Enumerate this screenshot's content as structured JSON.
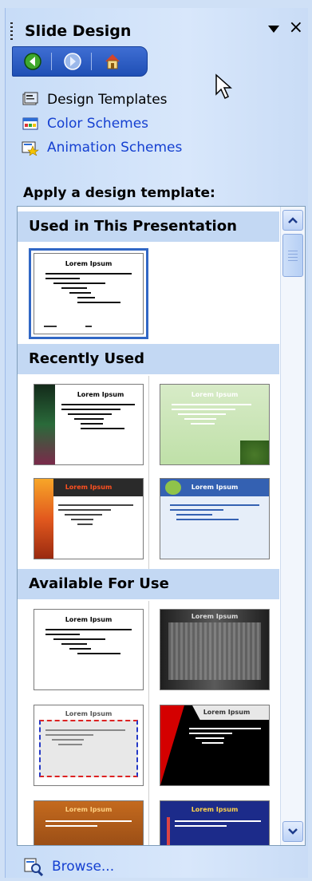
{
  "pane": {
    "title": "Slide Design",
    "close_glyph": "×",
    "menu_icon": "dropdown-arrow-icon",
    "nav": {
      "back_icon": "back-arrow-icon",
      "forward_icon": "forward-arrow-icon",
      "home_icon": "home-icon"
    }
  },
  "links": [
    {
      "label": "Design Templates",
      "icon": "design-templates-icon",
      "active": true
    },
    {
      "label": "Color Schemes",
      "icon": "color-schemes-icon",
      "active": false
    },
    {
      "label": "Animation Schemes",
      "icon": "animation-schemes-icon",
      "active": false
    }
  ],
  "apply_label": "Apply a design template:",
  "gallery": {
    "sections": [
      {
        "title": "Used in This Presentation"
      },
      {
        "title": "Recently Used"
      },
      {
        "title": "Available For Use"
      }
    ],
    "thumb_title": "Lorem Ipsum"
  },
  "browse_label": "Browse...",
  "colors": {
    "link_blue": "#1540d1",
    "section_header": "#c3d8f3",
    "nav_blue": "#1f4fb5",
    "selection": "#3167c5"
  }
}
